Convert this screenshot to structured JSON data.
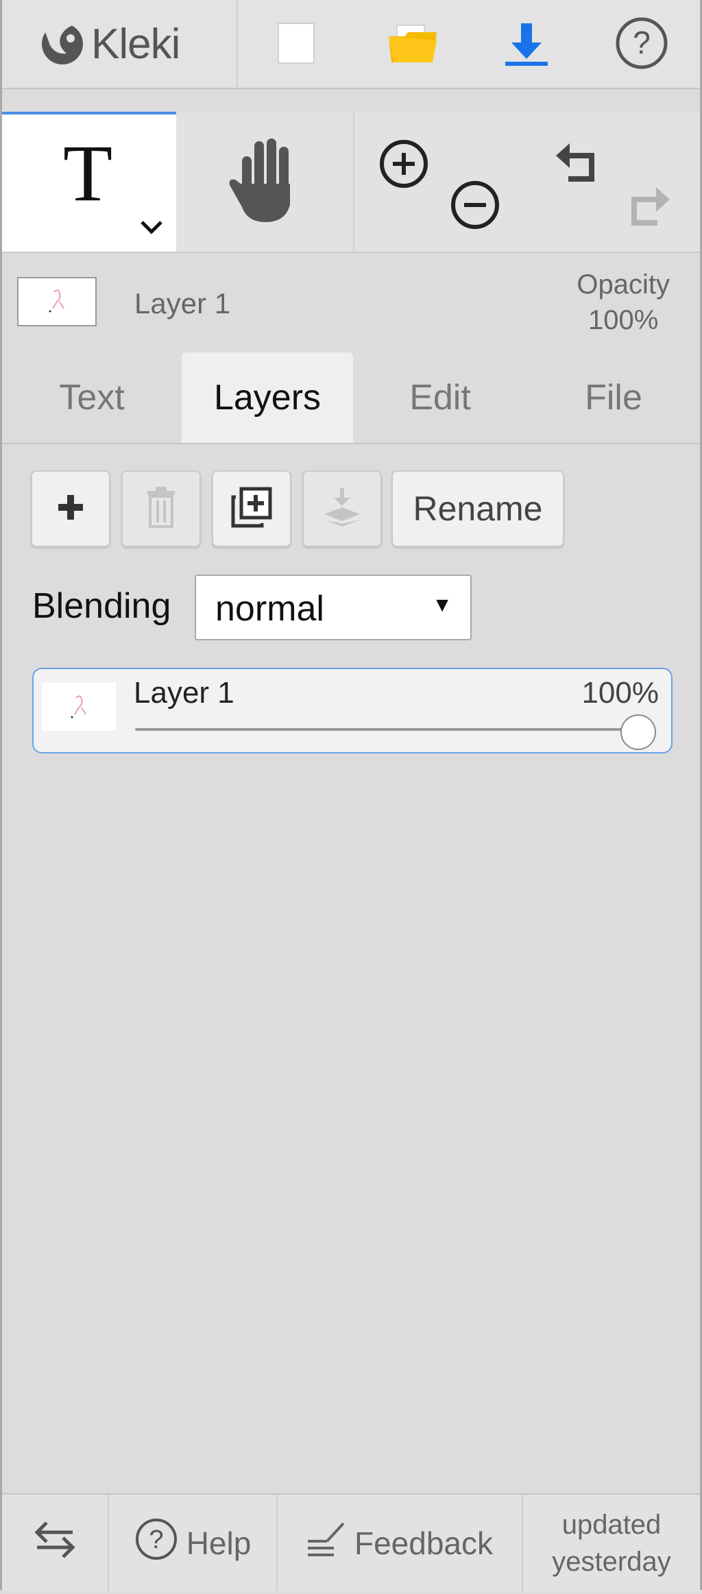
{
  "app": {
    "name": "Kleki"
  },
  "topbar": {
    "icons": [
      "kleki-logo-icon",
      "new-document-icon",
      "open-folder-icon",
      "download-icon",
      "help-icon"
    ]
  },
  "tools": {
    "active": "text",
    "icons": [
      "text-tool-icon",
      "hand-tool-icon",
      "zoom-in-icon",
      "zoom-out-icon",
      "undo-icon",
      "redo-icon"
    ]
  },
  "current_layer": {
    "name": "Layer 1",
    "opacity_label": "Opacity",
    "opacity_value": "100%"
  },
  "tabs": [
    {
      "label": "Text",
      "active": false
    },
    {
      "label": "Layers",
      "active": true
    },
    {
      "label": "Edit",
      "active": false
    },
    {
      "label": "File",
      "active": false
    }
  ],
  "layers_panel": {
    "buttons": {
      "add": "add-layer-icon",
      "delete": "delete-layer-icon",
      "duplicate": "duplicate-layer-icon",
      "merge": "merge-down-icon",
      "rename_label": "Rename"
    },
    "blending_label": "Blending",
    "blending_value": "normal",
    "layers": [
      {
        "name": "Layer 1",
        "opacity": "100%",
        "opacity_fraction": 1.0,
        "selected": true
      }
    ]
  },
  "footer": {
    "swap_icon": "swap-arrows-icon",
    "help_label": "Help",
    "feedback_label": "Feedback",
    "updated_line1": "updated",
    "updated_line2": "yesterday"
  },
  "colors": {
    "accent": "#4a90e2",
    "folder": "#f5b900",
    "download": "#1a73e8",
    "panel_bg": "#dcdcdc"
  }
}
